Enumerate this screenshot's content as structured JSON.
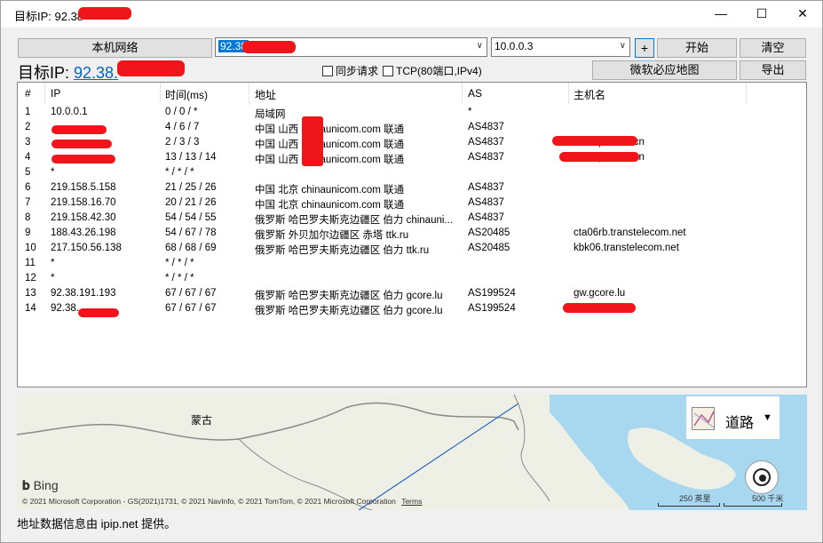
{
  "window": {
    "title": "目标IP: 92.38",
    "minimize": "—",
    "maximize": "☐",
    "close": "✕"
  },
  "toolbar": {
    "local_network_label": "本机网络",
    "target_input_value": "92.38",
    "source_select_value": "10.0.0.3",
    "add_label": "+",
    "start_label": "开始",
    "clear_label": "清空",
    "sync_request_label": "同步请求",
    "tcp_label": "TCP(80端口,IPv4)",
    "bing_map_label": "微软必应地图",
    "export_label": "导出"
  },
  "target": {
    "prefix": "目标IP: ",
    "ip": "92.38."
  },
  "table": {
    "columns": [
      "#",
      "IP",
      "时间(ms)",
      "地址",
      "AS",
      "主机名"
    ],
    "rows": [
      {
        "no": "1",
        "ip": "10.0.0.1",
        "time": "0 / 0 / *",
        "addr": "局域网",
        "as": "*",
        "host": ""
      },
      {
        "no": "2",
        "ip": "",
        "time": "4 / 6 / 7",
        "addr": "中国 山西     chinaunicom.com 联通",
        "as": "AS4837",
        "host": ""
      },
      {
        "no": "3",
        "ip": "",
        "time": "2 / 3 / 3",
        "addr": "中国 山西     chinaunicom.com 联通",
        "as": "AS4837",
        "host": ".adsl-pool.sx.cn"
      },
      {
        "no": "4",
        "ip": "",
        "time": "13 / 13 / 14",
        "addr": "中国 山西     chinaunicom.com 联通",
        "as": "AS4837",
        "host": ".adsl-pool.sx.cn"
      },
      {
        "no": "5",
        "ip": "*",
        "time": "* / * / *",
        "addr": "",
        "as": "",
        "host": ""
      },
      {
        "no": "6",
        "ip": "219.158.5.158",
        "time": "21 / 25 / 26",
        "addr": "中国 北京 chinaunicom.com 联通",
        "as": "AS4837",
        "host": ""
      },
      {
        "no": "7",
        "ip": "219.158.16.70",
        "time": "20 / 21 / 26",
        "addr": "中国 北京 chinaunicom.com 联通",
        "as": "AS4837",
        "host": ""
      },
      {
        "no": "8",
        "ip": "219.158.42.30",
        "time": "54 / 54 / 55",
        "addr": "俄罗斯 哈巴罗夫斯克边疆区 伯力 chinauni...",
        "as": "AS4837",
        "host": ""
      },
      {
        "no": "9",
        "ip": "188.43.26.198",
        "time": "54 / 67 / 78",
        "addr": "俄罗斯 外贝加尔边疆区 赤塔 ttk.ru",
        "as": "AS20485",
        "host": "cta06rb.transtelecom.net"
      },
      {
        "no": "10",
        "ip": "217.150.56.138",
        "time": "68 / 68 / 69",
        "addr": "俄罗斯 哈巴罗夫斯克边疆区 伯力 ttk.ru",
        "as": "AS20485",
        "host": "kbk06.transtelecom.net"
      },
      {
        "no": "11",
        "ip": "*",
        "time": "* / * / *",
        "addr": "",
        "as": "",
        "host": ""
      },
      {
        "no": "12",
        "ip": "*",
        "time": "* / * / *",
        "addr": "",
        "as": "",
        "host": ""
      },
      {
        "no": "13",
        "ip": "92.38.191.193",
        "time": "67 / 67 / 67",
        "addr": "俄罗斯 哈巴罗夫斯克边疆区 伯力 gcore.lu",
        "as": "AS199524",
        "host": "gw.gcore.lu"
      },
      {
        "no": "14",
        "ip": "92.38.",
        "time": "67 / 67 / 67",
        "addr": "俄罗斯 哈巴罗夫斯克边疆区 伯力 gcore.lu",
        "as": "AS199524",
        "host": ""
      }
    ]
  },
  "map": {
    "region_label": "蒙古",
    "style_label": "道路",
    "bing_label": "Bing",
    "copyright": "© 2021 Microsoft Corporation - GS(2021)1731, © 2021 NavInfo, © 2021 TomTom, © 2021 Microsoft Corporation",
    "terms_label": "Terms",
    "scale_miles": "250 英里",
    "scale_km": "500 千米",
    "colors": {
      "land": "#eef0e6",
      "water": "#a8d8f0"
    }
  },
  "status": {
    "text": "地址数据信息由 ipip.net 提供。"
  }
}
